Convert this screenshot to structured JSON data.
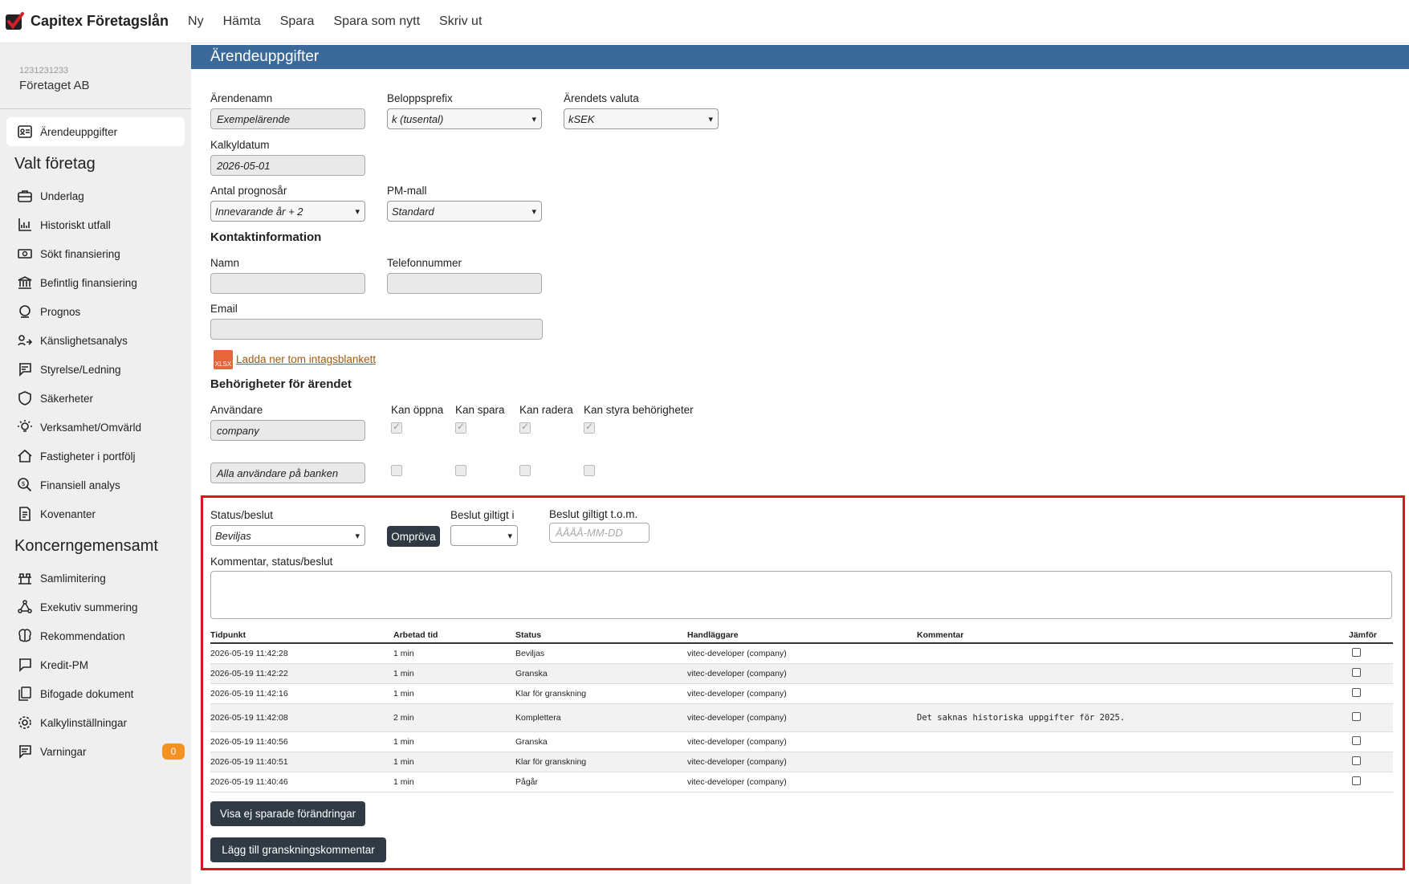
{
  "app": {
    "brand": "Capitex Företagslån",
    "menu": [
      "Ny",
      "Hämta",
      "Spara",
      "Spara som nytt",
      "Skriv ut"
    ]
  },
  "company": {
    "id": "1231231233",
    "name": "Företaget AB"
  },
  "sidebar": {
    "active": {
      "label": "Ärendeuppgifter",
      "icon": "id-card-icon"
    },
    "section1": "Valt företag",
    "items1": [
      {
        "label": "Underlag",
        "icon": "briefcase-icon"
      },
      {
        "label": "Historiskt utfall",
        "icon": "chart-icon"
      },
      {
        "label": "Sökt finansiering",
        "icon": "money-icon"
      },
      {
        "label": "Befintlig finansiering",
        "icon": "bank-icon"
      },
      {
        "label": "Prognos",
        "icon": "crystal-ball-icon"
      },
      {
        "label": "Känslighetsanalys",
        "icon": "sensitivity-icon"
      },
      {
        "label": "Styrelse/Ledning",
        "icon": "board-icon"
      },
      {
        "label": "Säkerheter",
        "icon": "shield-icon"
      },
      {
        "label": "Verksamhet/Omvärld",
        "icon": "lightbulb-icon"
      },
      {
        "label": "Fastigheter i portfölj",
        "icon": "house-icon"
      },
      {
        "label": "Finansiell analys",
        "icon": "analysis-icon"
      },
      {
        "label": "Kovenanter",
        "icon": "document-icon"
      }
    ],
    "section2": "Koncerngemensamt",
    "items2": [
      {
        "label": "Samlimitering",
        "icon": "limit-icon"
      },
      {
        "label": "Exekutiv summering",
        "icon": "network-icon"
      },
      {
        "label": "Rekommendation",
        "icon": "brain-icon"
      },
      {
        "label": "Kredit-PM",
        "icon": "memo-icon"
      },
      {
        "label": "Bifogade dokument",
        "icon": "attachment-icon"
      },
      {
        "label": "Kalkylinställningar",
        "icon": "settings-icon"
      },
      {
        "label": "Varningar",
        "icon": "warning-icon",
        "badge": "0"
      }
    ]
  },
  "page": {
    "title": "Ärendeuppgifter",
    "case_name_label": "Ärendenamn",
    "case_name_value": "Exempelärende",
    "prefix_label": "Beloppsprefix",
    "prefix_value": "k (tusental)",
    "currency_label": "Ärendets valuta",
    "currency_value": "kSEK",
    "calc_date_label": "Kalkyldatum",
    "calc_date_value": "2026-05-01",
    "forecast_label": "Antal prognosår",
    "forecast_value": "Innevarande år + 2",
    "pm_label": "PM-mall",
    "pm_value": "Standard",
    "contact_title": "Kontaktinformation",
    "name_label": "Namn",
    "phone_label": "Telefonnummer",
    "email_label": "Email",
    "xlsx_icon": "XLSX",
    "download_link": "Ladda ner tom intagsblankett",
    "perm_title": "Behörigheter för ärendet",
    "perm_user_label": "Användare",
    "perm_cols": [
      "Kan öppna",
      "Kan spara",
      "Kan radera",
      "Kan styra behörigheter"
    ],
    "perm_rows": [
      {
        "user": "company",
        "checks": [
          true,
          true,
          true,
          true
        ]
      },
      {
        "user": "Alla användare på banken",
        "checks": [
          false,
          false,
          false,
          false
        ]
      }
    ]
  },
  "status": {
    "status_label": "Status/beslut",
    "status_value": "Beviljas",
    "reconsider_button": "Ompröva",
    "valid_in_label": "Beslut giltigt i",
    "valid_in_value": "",
    "valid_until_label": "Beslut giltigt t.o.m.",
    "valid_until_placeholder": "ÅÅÅÅ-MM-DD",
    "comment_label": "Kommentar, status/beslut",
    "table_headers": [
      "Tidpunkt",
      "Arbetad tid",
      "Status",
      "Handläggare",
      "Kommentar",
      "Jämför"
    ],
    "rows": [
      {
        "time": "2026-05-19 11:42:28",
        "worked": "1 min",
        "status": "Beviljas",
        "handler": "vitec-developer (company)",
        "comment": ""
      },
      {
        "time": "2026-05-19 11:42:22",
        "worked": "1 min",
        "status": "Granska",
        "handler": "vitec-developer (company)",
        "comment": ""
      },
      {
        "time": "2026-05-19 11:42:16",
        "worked": "1 min",
        "status": "Klar för granskning",
        "handler": "vitec-developer (company)",
        "comment": ""
      },
      {
        "time": "2026-05-19 11:42:08",
        "worked": "2 min",
        "status": "Komplettera",
        "handler": "vitec-developer (company)",
        "comment": "Det saknas historiska uppgifter för 2025."
      },
      {
        "time": "2026-05-19 11:40:56",
        "worked": "1 min",
        "status": "Granska",
        "handler": "vitec-developer (company)",
        "comment": ""
      },
      {
        "time": "2026-05-19 11:40:51",
        "worked": "1 min",
        "status": "Klar för granskning",
        "handler": "vitec-developer (company)",
        "comment": ""
      },
      {
        "time": "2026-05-19 11:40:46",
        "worked": "1 min",
        "status": "Pågår",
        "handler": "vitec-developer (company)",
        "comment": ""
      }
    ],
    "show_unsaved_button": "Visa ej sparade förändringar",
    "add_review_comment_button": "Lägg till granskningskommentar"
  }
}
